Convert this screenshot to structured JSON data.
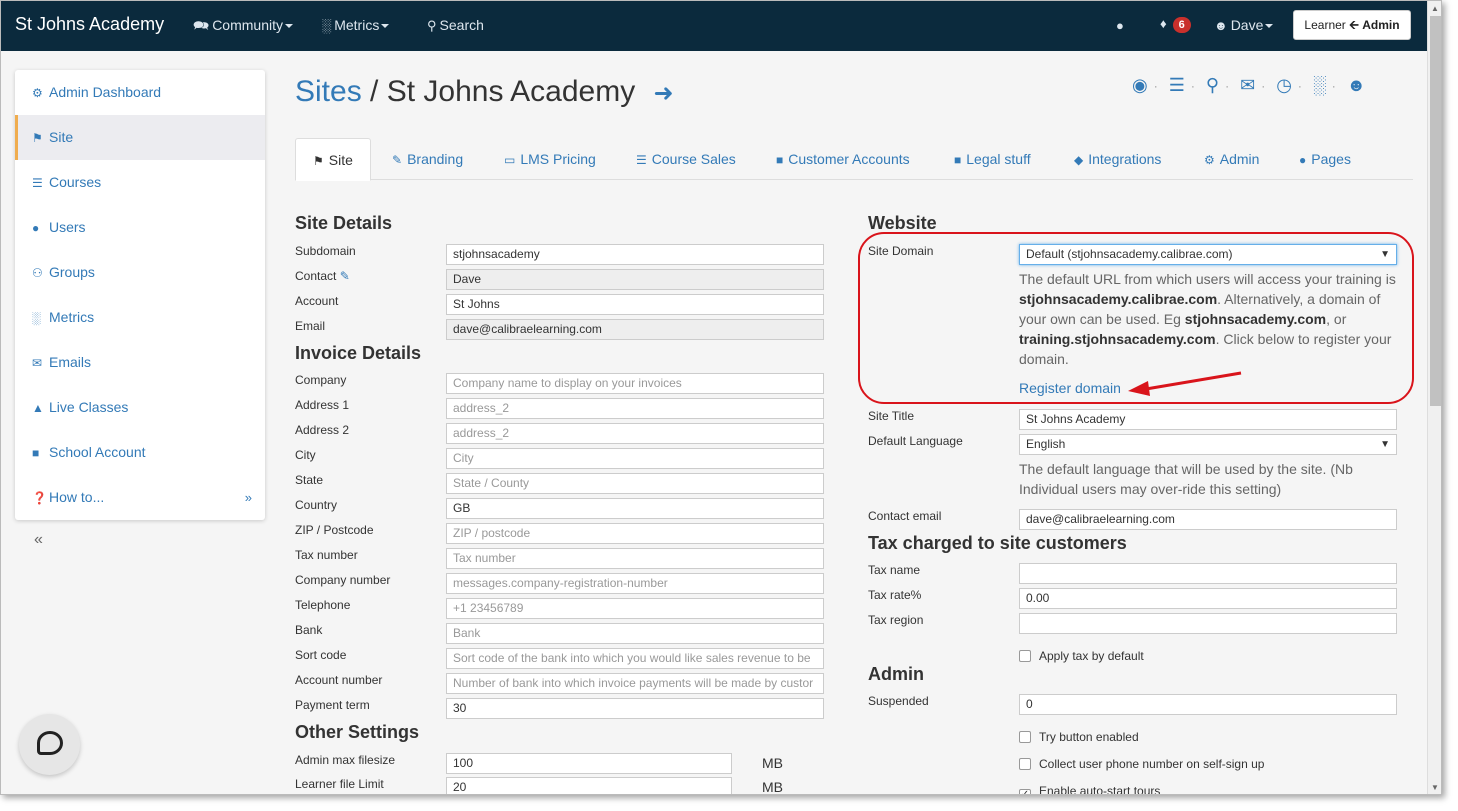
{
  "nav": {
    "brand": "St Johns Academy",
    "community": "Community",
    "metrics": "Metrics",
    "search": "Search",
    "notifications": "6",
    "user": "Dave",
    "role_left": "Learner",
    "role_right": "Admin"
  },
  "sidebar": {
    "items": [
      {
        "label": "Admin Dashboard",
        "icon": "cogs-icon"
      },
      {
        "label": "Site",
        "icon": "flag-icon"
      },
      {
        "label": "Courses",
        "icon": "list-icon"
      },
      {
        "label": "Users",
        "icon": "user-icon"
      },
      {
        "label": "Groups",
        "icon": "users-icon"
      },
      {
        "label": "Metrics",
        "icon": "bar-chart-icon"
      },
      {
        "label": "Emails",
        "icon": "envelope-icon"
      },
      {
        "label": "Live Classes",
        "icon": "graduation-cap-icon"
      },
      {
        "label": "School Account",
        "icon": "book-icon"
      },
      {
        "label": "How to...",
        "icon": "question-circle-icon"
      }
    ]
  },
  "page": {
    "crumb": "Sites",
    "separator": "/",
    "title": "St Johns Academy"
  },
  "tabs": [
    "Site",
    "Branding",
    "LMS Pricing",
    "Course Sales",
    "Customer Accounts",
    "Legal stuff",
    "Integrations",
    "Admin",
    "Pages"
  ],
  "site_details": {
    "heading": "Site Details",
    "subdomain_label": "Subdomain",
    "subdomain": "stjohnsacademy",
    "contact_label": "Contact",
    "contact": "Dave",
    "account_label": "Account",
    "account": "St Johns",
    "email_label": "Email",
    "email": "dave@calibraelearning.com"
  },
  "invoice": {
    "heading": "Invoice Details",
    "fields": [
      {
        "label": "Company",
        "value": "Company name to display on your invoices",
        "placeholder": true
      },
      {
        "label": "Address 1",
        "value": "address_2",
        "placeholder": true
      },
      {
        "label": "Address 2",
        "value": "address_2",
        "placeholder": true
      },
      {
        "label": "City",
        "value": "City",
        "placeholder": true
      },
      {
        "label": "State",
        "value": "State / County",
        "placeholder": true
      },
      {
        "label": "Country",
        "value": "GB",
        "placeholder": false
      },
      {
        "label": "ZIP / Postcode",
        "value": "ZIP / postcode",
        "placeholder": true
      },
      {
        "label": "Tax number",
        "value": "Tax number",
        "placeholder": true
      },
      {
        "label": "Company number",
        "value": "messages.company-registration-number",
        "placeholder": true
      },
      {
        "label": "Telephone",
        "value": "+1 23456789",
        "placeholder": true
      },
      {
        "label": "Bank",
        "value": "Bank",
        "placeholder": true
      },
      {
        "label": "Sort code",
        "value": "Sort code of the bank into which you would like sales revenue to be",
        "placeholder": true
      },
      {
        "label": "Account number",
        "value": "Number of bank into which invoice payments will be made by custor",
        "placeholder": true
      },
      {
        "label": "Payment term",
        "value": "30",
        "placeholder": false
      }
    ]
  },
  "other": {
    "heading": "Other Settings",
    "admin_max_label": "Admin max filesize",
    "admin_max": "100",
    "admin_max_unit": "MB",
    "learner_limit_label": "Learner file Limit",
    "learner_limit": "20",
    "learner_limit_unit": "MB"
  },
  "website": {
    "heading": "Website",
    "domain_label": "Site Domain",
    "domain_value": "Default (stjohnsacademy.calibrae.com)",
    "help_1": "The default URL from which users will access your training is ",
    "help_domain": "stjohnsacademy.calibrae.com",
    "help_2": ". Alternatively, a domain of your own can be used. Eg ",
    "help_eg1": "stjohnsacademy.com",
    "help_3": ", or ",
    "help_eg2": "training.stjohnsacademy.com",
    "help_4": ". Click below to register your domain.",
    "register_link": "Register domain",
    "title_label": "Site Title",
    "title_value": "St Johns Academy",
    "language_label": "Default Language",
    "language_value": "English",
    "language_help": "The default language that will be used by the site. (Nb Individual users may over-ride this setting)",
    "contact_email_label": "Contact email",
    "contact_email": "dave@calibraelearning.com"
  },
  "tax": {
    "heading": "Tax charged to site customers",
    "name_label": "Tax name",
    "name_value": "",
    "rate_label": "Tax rate%",
    "rate_value": "0.00",
    "region_label": "Tax region",
    "region_value": "",
    "apply_label": "Apply tax by default"
  },
  "admin": {
    "heading": "Admin",
    "suspended_label": "Suspended",
    "suspended_value": "0",
    "try_button": "Try button enabled",
    "collect_phone": "Collect user phone number on self-sign up",
    "auto_tours": "Enable auto-start tours"
  },
  "colors": {
    "navbar": "#0b2a3d",
    "link": "#337ab7",
    "annotation": "#d9141b",
    "badge": "#c9302c"
  }
}
